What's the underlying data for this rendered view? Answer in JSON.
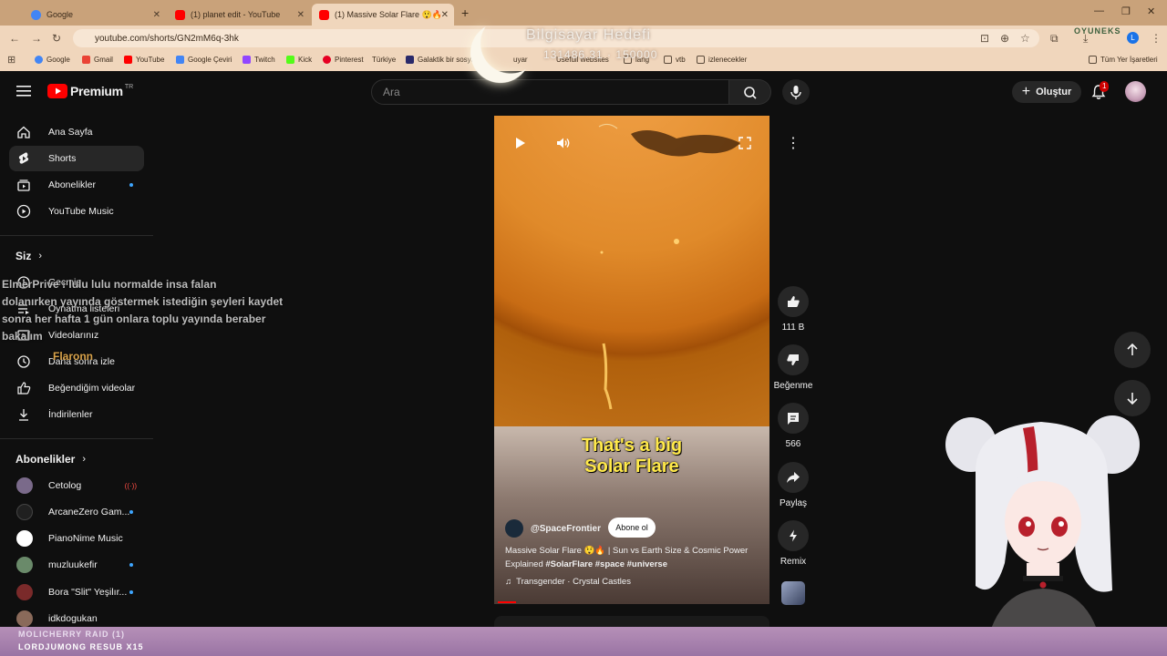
{
  "browser": {
    "tabs": [
      {
        "title": "Google",
        "favicon_color": "#4285f4"
      },
      {
        "title": "(1) planet edit - YouTube",
        "favicon_color": "#ff0000"
      },
      {
        "title": "(1) Massive Solar Flare 😲🔥",
        "favicon_color": "#ff0000"
      }
    ],
    "url": "youtube.com/shorts/GN2mM6q-3hk",
    "bookmarks": [
      "Google",
      "Gmail",
      "YouTube",
      "Google Çeviri",
      "Twitch",
      "Kick",
      "Pinterest",
      "Türkiye",
      "Galaktik bir sosyal...",
      "uyar",
      "Usefull websites",
      "lang",
      "vtb",
      "izlenecekler",
      "Tüm Yer İşaretleri"
    ]
  },
  "overlay": {
    "goal_title": "Bilgisayar Hedefi",
    "goal_value": "131486.31 · 150000",
    "watermark": "OYUNEKS",
    "chat_lines": [
      "ElmerPrive : lulu lulu normalde insa falan",
      "dolanırken yayında göstermek istediğin şeyleri kaydet",
      "sonra her hafta 1 gün onlara toplu yayında beraber",
      "bakalım"
    ],
    "chat_user2": "Flaronn",
    "bottom_line1": "MOLICHERRY RAID (1)",
    "bottom_line2": "LORDJUMONG RESUB X15"
  },
  "yt": {
    "logo_text": "Premium",
    "logo_badge": "TR",
    "search_placeholder": "Ara",
    "create_label": "Oluştur",
    "notif_count": "1",
    "sidebar": {
      "main": [
        "Ana Sayfa",
        "Shorts",
        "Abonelikler",
        "YouTube Music"
      ],
      "you_header": "Siz",
      "you_items": [
        "Geçmiş",
        "Oynatma listeleri",
        "Videolarınız",
        "Daha sonra izle",
        "Beğendiğim videolar",
        "İndirilenler"
      ],
      "subs_header": "Abonelikler",
      "subs": [
        {
          "name": "Cetolog",
          "color": "#7a6a8a"
        },
        {
          "name": "ArcaneZero Gam...",
          "color": "#202020"
        },
        {
          "name": "PianoNime Music",
          "color": "#ffffff"
        },
        {
          "name": "muzluukefir",
          "color": "#6a8a6a"
        },
        {
          "name": "Bora \"Slit\" Yeşilır...",
          "color": "#7a2a2a"
        },
        {
          "name": "idkdogukan",
          "color": "#8a6a5a"
        }
      ]
    },
    "short": {
      "caption_line1": "That's a big",
      "caption_line2": "Solar Flare",
      "channel": "@SpaceFrontier",
      "subscribe": "Abone ol",
      "title_plain": "Massive Solar Flare 😲🔥 | Sun vs Earth Size & Cosmic Power Explained ",
      "title_tags": "#SolarFlare #space #universe",
      "music": "Transgender · Crystal Castles"
    },
    "actions": {
      "likes": "111 B",
      "dislike": "Beğenme",
      "comments": "566",
      "share": "Paylaş",
      "remix": "Remix"
    }
  }
}
